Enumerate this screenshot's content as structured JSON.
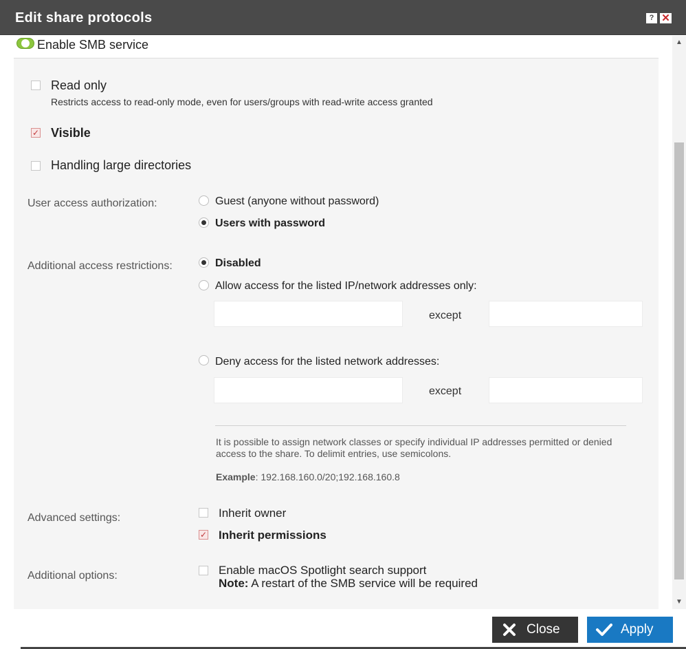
{
  "dialog": {
    "title": "Edit share protocols",
    "help_label": "?",
    "close_label": "✕"
  },
  "smb_toggle": {
    "label": "Enable SMB service",
    "enabled": true
  },
  "read_only": {
    "label": "Read only",
    "description": "Restricts access to read-only mode, even for users/groups with read-write access granted",
    "checked": false
  },
  "visible": {
    "label": "Visible",
    "checked": true
  },
  "large_dirs": {
    "label": "Handling large directories",
    "checked": false
  },
  "user_access": {
    "label": "User access authorization:",
    "options": [
      {
        "label": "Guest (anyone without password)",
        "selected": false
      },
      {
        "label": "Users with password",
        "selected": true
      }
    ]
  },
  "access_restrictions": {
    "label": "Additional access restrictions:",
    "options": [
      {
        "label": "Disabled",
        "selected": true
      },
      {
        "label": "Allow access for the listed IP/network addresses only:",
        "selected": false
      },
      {
        "label": "Deny access for the listed network addresses:",
        "selected": false
      }
    ],
    "except_label": "except",
    "allow_value": "",
    "allow_except_value": "",
    "deny_value": "",
    "deny_except_value": "",
    "info_text": "It is possible to assign network classes or specify individual IP addresses permitted or denied access to the share. To delimit entries, use semicolons.",
    "example_label": "Example",
    "example_value": ": 192.168.160.0/20;192.168.160.8"
  },
  "advanced": {
    "label": "Advanced settings:",
    "inherit_owner": {
      "label": "Inherit owner",
      "checked": false
    },
    "inherit_permissions": {
      "label": "Inherit permissions",
      "checked": true
    }
  },
  "additional_options": {
    "label": "Additional options:",
    "spotlight": {
      "label": "Enable macOS Spotlight search support",
      "checked": false
    },
    "note_label": "Note:",
    "note_text": " A restart of the SMB service will be required"
  },
  "buttons": {
    "close": "Close",
    "apply": "Apply"
  },
  "colors": {
    "titlebar": "#4a4a4a",
    "apply": "#1979c3",
    "close": "#353535",
    "toggle": "#8cc63e",
    "check": "#c0393b"
  }
}
